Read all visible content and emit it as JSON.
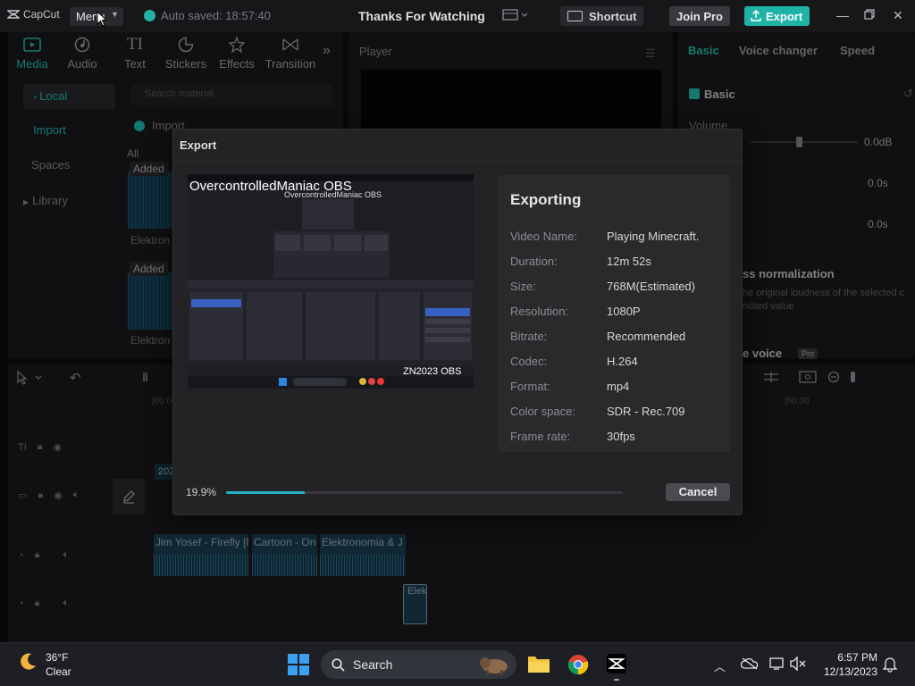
{
  "app": {
    "logo": "CapCut",
    "menu_label": "Menu",
    "autosave": "Auto saved: 18:57:40",
    "project_title": "Thanks For Watching",
    "shortcut_label": "Shortcut",
    "join_pro_label": "Join Pro",
    "export_label": "Export"
  },
  "media_tabs": [
    {
      "label": "Media",
      "icon": "media-icon"
    },
    {
      "label": "Audio",
      "icon": "audio-icon"
    },
    {
      "label": "Text",
      "icon": "text-icon"
    },
    {
      "label": "Stickers",
      "icon": "stickers-icon"
    },
    {
      "label": "Effects",
      "icon": "effects-icon"
    },
    {
      "label": "Transition",
      "icon": "transition-icon"
    }
  ],
  "media_side": {
    "local": "Local",
    "import": "Import",
    "spaces": "Spaces",
    "library": "Library"
  },
  "media_area": {
    "search_placeholder": "Search material",
    "import_label": "Import",
    "filter_all": "All",
    "clips": [
      {
        "badge": "Added",
        "name": "Elektron"
      },
      {
        "badge": "Added",
        "name": "Elektron"
      }
    ]
  },
  "player": {
    "label": "Player"
  },
  "right_panel": {
    "tabs": [
      "Basic",
      "Voice changer",
      "Speed"
    ],
    "basic_section": "Basic",
    "volume_label": "Volume",
    "volume_value": "0.0dB",
    "fade_in_value": "0.0s",
    "fade_out_value": "0.0s",
    "normalization_title": "ss normalization",
    "normalization_desc_1": "he original loudness of the selected c",
    "normalization_desc_2": "ndard value",
    "voice_label": "e voice",
    "pro_badge": "Pro"
  },
  "timeline": {
    "ruler_start": "|00:00",
    "ruler_mark": "|50:00",
    "clip_prefix": "202",
    "audio_clips": [
      {
        "name": "Jim Yosef - Firefly [N"
      },
      {
        "name": "Cartoon - On"
      },
      {
        "name": "Elektronomia & J"
      }
    ],
    "small_clip": "Elek"
  },
  "export_dialog": {
    "title": "Export",
    "preview_overlay_left": "OvercontrolledManiac OBS",
    "preview_overlay_right": "ZN2023 OBS",
    "preview_inner_title": "OvercontrolledManiac OBS",
    "heading": "Exporting",
    "details": [
      {
        "key": "Video Name:",
        "value": "Playing Minecraft."
      },
      {
        "key": "Duration:",
        "value": "12m 52s"
      },
      {
        "key": "Size:",
        "value": "768M(Estimated)"
      },
      {
        "key": "Resolution:",
        "value": "1080P"
      },
      {
        "key": "Bitrate:",
        "value": "Recommended"
      },
      {
        "key": "Codec:",
        "value": "H.264"
      },
      {
        "key": "Format:",
        "value": "mp4"
      },
      {
        "key": "Color space:",
        "value": "SDR - Rec.709"
      },
      {
        "key": "Frame rate:",
        "value": "30fps"
      }
    ],
    "progress_label": "19.9%",
    "progress_value": 0.199,
    "cancel_label": "Cancel"
  },
  "taskbar": {
    "weather_temp": "36°F",
    "weather_desc": "Clear",
    "search_label": "Search",
    "time": "6:57 PM",
    "date": "12/13/2023"
  },
  "colors": {
    "accent": "#22c2b6",
    "export_button": "#1fb3a8",
    "progress": "#23b2c4"
  }
}
